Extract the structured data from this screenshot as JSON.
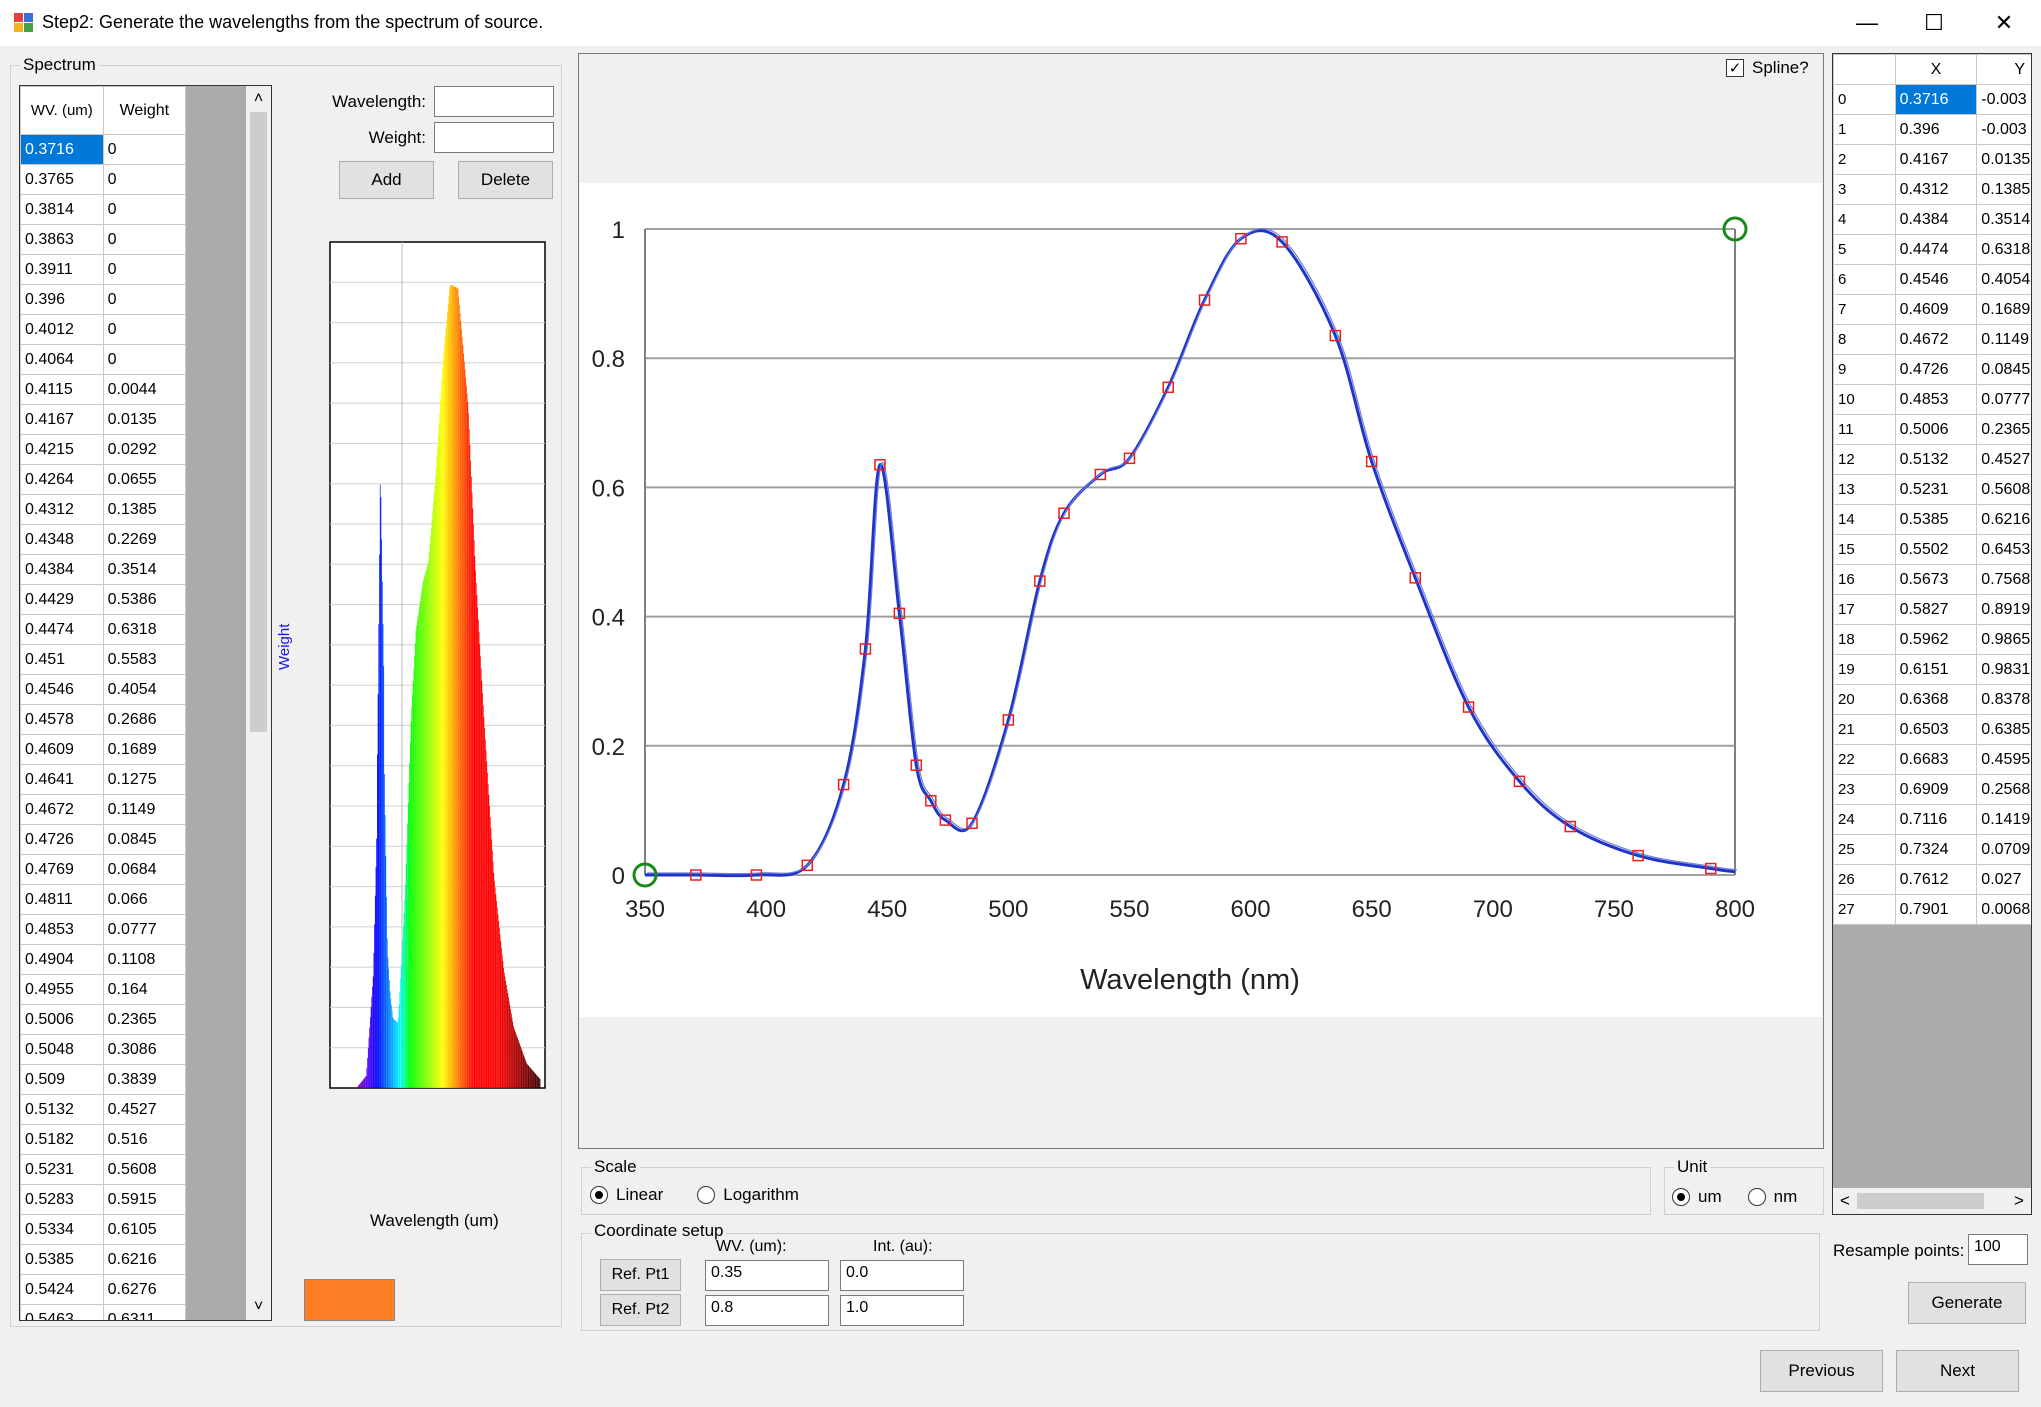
{
  "window": {
    "title": "Step2: Generate the wavelengths from the spectrum of source.",
    "minimize_glyph": "—",
    "maximize_glyph": "☐",
    "close_glyph": "✕"
  },
  "spectrum_group": {
    "label": "Spectrum",
    "columns": [
      "WV. (um)",
      "Weight"
    ],
    "selected_row": 0,
    "rows": [
      [
        "0.3716",
        "0"
      ],
      [
        "0.3765",
        "0"
      ],
      [
        "0.3814",
        "0"
      ],
      [
        "0.3863",
        "0"
      ],
      [
        "0.3911",
        "0"
      ],
      [
        "0.396",
        "0"
      ],
      [
        "0.4012",
        "0"
      ],
      [
        "0.4064",
        "0"
      ],
      [
        "0.4115",
        "0.0044"
      ],
      [
        "0.4167",
        "0.0135"
      ],
      [
        "0.4215",
        "0.0292"
      ],
      [
        "0.4264",
        "0.0655"
      ],
      [
        "0.4312",
        "0.1385"
      ],
      [
        "0.4348",
        "0.2269"
      ],
      [
        "0.4384",
        "0.3514"
      ],
      [
        "0.4429",
        "0.5386"
      ],
      [
        "0.4474",
        "0.6318"
      ],
      [
        "0.451",
        "0.5583"
      ],
      [
        "0.4546",
        "0.4054"
      ],
      [
        "0.4578",
        "0.2686"
      ],
      [
        "0.4609",
        "0.1689"
      ],
      [
        "0.4641",
        "0.1275"
      ],
      [
        "0.4672",
        "0.1149"
      ],
      [
        "0.4726",
        "0.0845"
      ],
      [
        "0.4769",
        "0.0684"
      ],
      [
        "0.4811",
        "0.066"
      ],
      [
        "0.4853",
        "0.0777"
      ],
      [
        "0.4904",
        "0.1108"
      ],
      [
        "0.4955",
        "0.164"
      ],
      [
        "0.5006",
        "0.2365"
      ],
      [
        "0.5048",
        "0.3086"
      ],
      [
        "0.509",
        "0.3839"
      ],
      [
        "0.5132",
        "0.4527"
      ],
      [
        "0.5182",
        "0.516"
      ],
      [
        "0.5231",
        "0.5608"
      ],
      [
        "0.5283",
        "0.5915"
      ],
      [
        "0.5334",
        "0.6105"
      ],
      [
        "0.5385",
        "0.6216"
      ],
      [
        "0.5424",
        "0.6276"
      ]
    ],
    "partial_row": [
      "0.5463",
      "0.6311"
    ],
    "scroll_up_glyph": "˄",
    "scroll_down_glyph": "˅",
    "wavelength_label": "Wavelength:",
    "wavelength_value": "",
    "weight_label": "Weight:",
    "weight_value": "",
    "add_label": "Add",
    "delete_label": "Delete",
    "mini_chart": {
      "ylabel": "Weight",
      "xlabel": "Wavelength (um)",
      "swatch_color": "#ff7f27"
    }
  },
  "main_chart": {
    "spline_label": "Spline?",
    "spline_checked": true,
    "check_glyph": "✓"
  },
  "chart_data": {
    "type": "line",
    "xlabel": "Wavelength (nm)",
    "ylabel": "",
    "xlim": [
      350,
      800
    ],
    "ylim": [
      0,
      1
    ],
    "x_ticks": [
      "350",
      "400",
      "450",
      "500",
      "550",
      "600",
      "650",
      "700",
      "750",
      "800"
    ],
    "y_ticks": [
      "0",
      "0.2",
      "0.4",
      "0.6",
      "0.8",
      "1"
    ],
    "grid": true,
    "line_color": "#1f35c9",
    "marker_color": "#e8201f",
    "ref_marker_color": "#1a8a1a",
    "series": [
      {
        "x": [
          350,
          371,
          396,
          417,
          432,
          441,
          447,
          455,
          462,
          468,
          474,
          485,
          500,
          513,
          523,
          538,
          550,
          566,
          581,
          596,
          613,
          635,
          650,
          668,
          690,
          711,
          732,
          760,
          790,
          800
        ],
        "y": [
          0,
          0,
          0,
          0.015,
          0.14,
          0.35,
          0.635,
          0.405,
          0.17,
          0.115,
          0.085,
          0.08,
          0.24,
          0.455,
          0.56,
          0.62,
          0.645,
          0.755,
          0.89,
          0.985,
          0.98,
          0.835,
          0.64,
          0.46,
          0.26,
          0.145,
          0.075,
          0.03,
          0.01,
          0.005
        ]
      }
    ],
    "sample_points": {
      "x": [
        371,
        396,
        417,
        432,
        441,
        447,
        455,
        462,
        468,
        474,
        485,
        500,
        513,
        523,
        538,
        550,
        566,
        581,
        596,
        613,
        635,
        650,
        668,
        690,
        711,
        732,
        760,
        790
      ],
      "y": [
        0,
        0,
        0.015,
        0.14,
        0.35,
        0.635,
        0.405,
        0.17,
        0.115,
        0.085,
        0.08,
        0.24,
        0.455,
        0.56,
        0.62,
        0.645,
        0.755,
        0.89,
        0.985,
        0.98,
        0.835,
        0.64,
        0.46,
        0.26,
        0.145,
        0.075,
        0.03,
        0.01
      ]
    },
    "reference_points": {
      "x": [
        350,
        800
      ],
      "y": [
        0,
        1
      ]
    }
  },
  "scale_group": {
    "label": "Scale",
    "options": [
      "Linear",
      "Logarithm"
    ],
    "selected": "Linear"
  },
  "unit_group": {
    "label": "Unit",
    "options": [
      "um",
      "nm"
    ],
    "selected": "um"
  },
  "coord_group": {
    "label": "Coordinate setup",
    "wv_header": "WV. (um):",
    "int_header": "Int. (au):",
    "ref1_label": "Ref. Pt1",
    "ref2_label": "Ref. Pt2",
    "ref1_wv": "0.35",
    "ref1_int": "0.0",
    "ref2_wv": "0.8",
    "ref2_int": "1.0"
  },
  "resample": {
    "columns": [
      "X",
      "Y"
    ],
    "selected_row": 0,
    "rows": [
      [
        "0",
        "0.3716",
        "-0.003"
      ],
      [
        "1",
        "0.396",
        "-0.003"
      ],
      [
        "2",
        "0.4167",
        "0.0135"
      ],
      [
        "3",
        "0.4312",
        "0.1385"
      ],
      [
        "4",
        "0.4384",
        "0.3514"
      ],
      [
        "5",
        "0.4474",
        "0.6318"
      ],
      [
        "6",
        "0.4546",
        "0.4054"
      ],
      [
        "7",
        "0.4609",
        "0.1689"
      ],
      [
        "8",
        "0.4672",
        "0.1149"
      ],
      [
        "9",
        "0.4726",
        "0.0845"
      ],
      [
        "10",
        "0.4853",
        "0.0777"
      ],
      [
        "11",
        "0.5006",
        "0.2365"
      ],
      [
        "12",
        "0.5132",
        "0.4527"
      ],
      [
        "13",
        "0.5231",
        "0.5608"
      ],
      [
        "14",
        "0.5385",
        "0.6216"
      ],
      [
        "15",
        "0.5502",
        "0.6453"
      ],
      [
        "16",
        "0.5673",
        "0.7568"
      ],
      [
        "17",
        "0.5827",
        "0.8919"
      ],
      [
        "18",
        "0.5962",
        "0.9865"
      ],
      [
        "19",
        "0.6151",
        "0.9831"
      ],
      [
        "20",
        "0.6368",
        "0.8378"
      ],
      [
        "21",
        "0.6503",
        "0.6385"
      ],
      [
        "22",
        "0.6683",
        "0.4595"
      ],
      [
        "23",
        "0.6909",
        "0.2568"
      ],
      [
        "24",
        "0.7116",
        "0.1419"
      ],
      [
        "25",
        "0.7324",
        "0.0709"
      ],
      [
        "26",
        "0.7612",
        "0.027"
      ],
      [
        "27",
        "0.7901",
        "0.0068"
      ]
    ],
    "scroll_left_glyph": "˂",
    "scroll_right_glyph": "˃",
    "points_label": "Resample points:",
    "points_value": "100",
    "generate_label": "Generate"
  },
  "footer": {
    "previous_label": "Previous",
    "next_label": "Next"
  }
}
